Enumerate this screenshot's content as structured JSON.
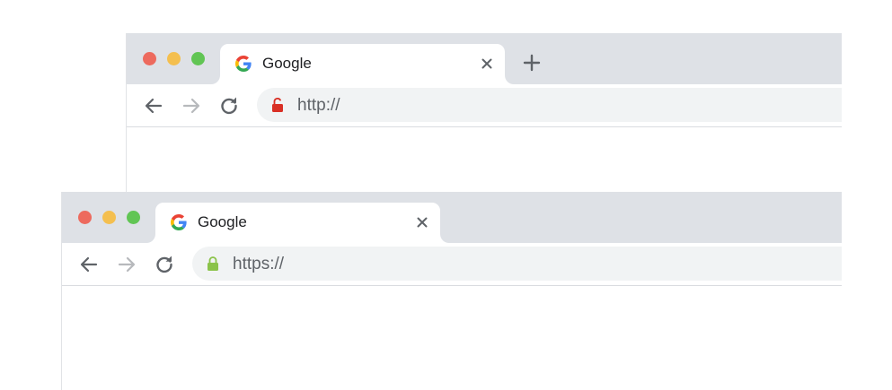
{
  "colors": {
    "traffic_red": "#ed6a5e",
    "traffic_yellow": "#f4bf4f",
    "traffic_green": "#61c554",
    "chrome_gray": "#dee1e6",
    "omnibox_gray": "#f1f3f4",
    "lock_insecure": "#d93025",
    "lock_secure": "#8bc34a"
  },
  "windows": [
    {
      "tab": {
        "favicon": "google-g-icon",
        "title": "Google",
        "close_icon": "close-icon"
      },
      "new_tab_icon": "plus-icon",
      "toolbar": {
        "back_icon": "arrow-left-icon",
        "forward_icon": "arrow-right-icon",
        "reload_icon": "reload-icon"
      },
      "address_bar": {
        "lock_icon": "lock-insecure-icon",
        "url": "http://"
      }
    },
    {
      "tab": {
        "favicon": "google-g-icon",
        "title": "Google",
        "close_icon": "close-icon"
      },
      "toolbar": {
        "back_icon": "arrow-left-icon",
        "forward_icon": "arrow-right-icon",
        "reload_icon": "reload-icon"
      },
      "address_bar": {
        "lock_icon": "lock-secure-icon",
        "url": "https://"
      }
    }
  ]
}
